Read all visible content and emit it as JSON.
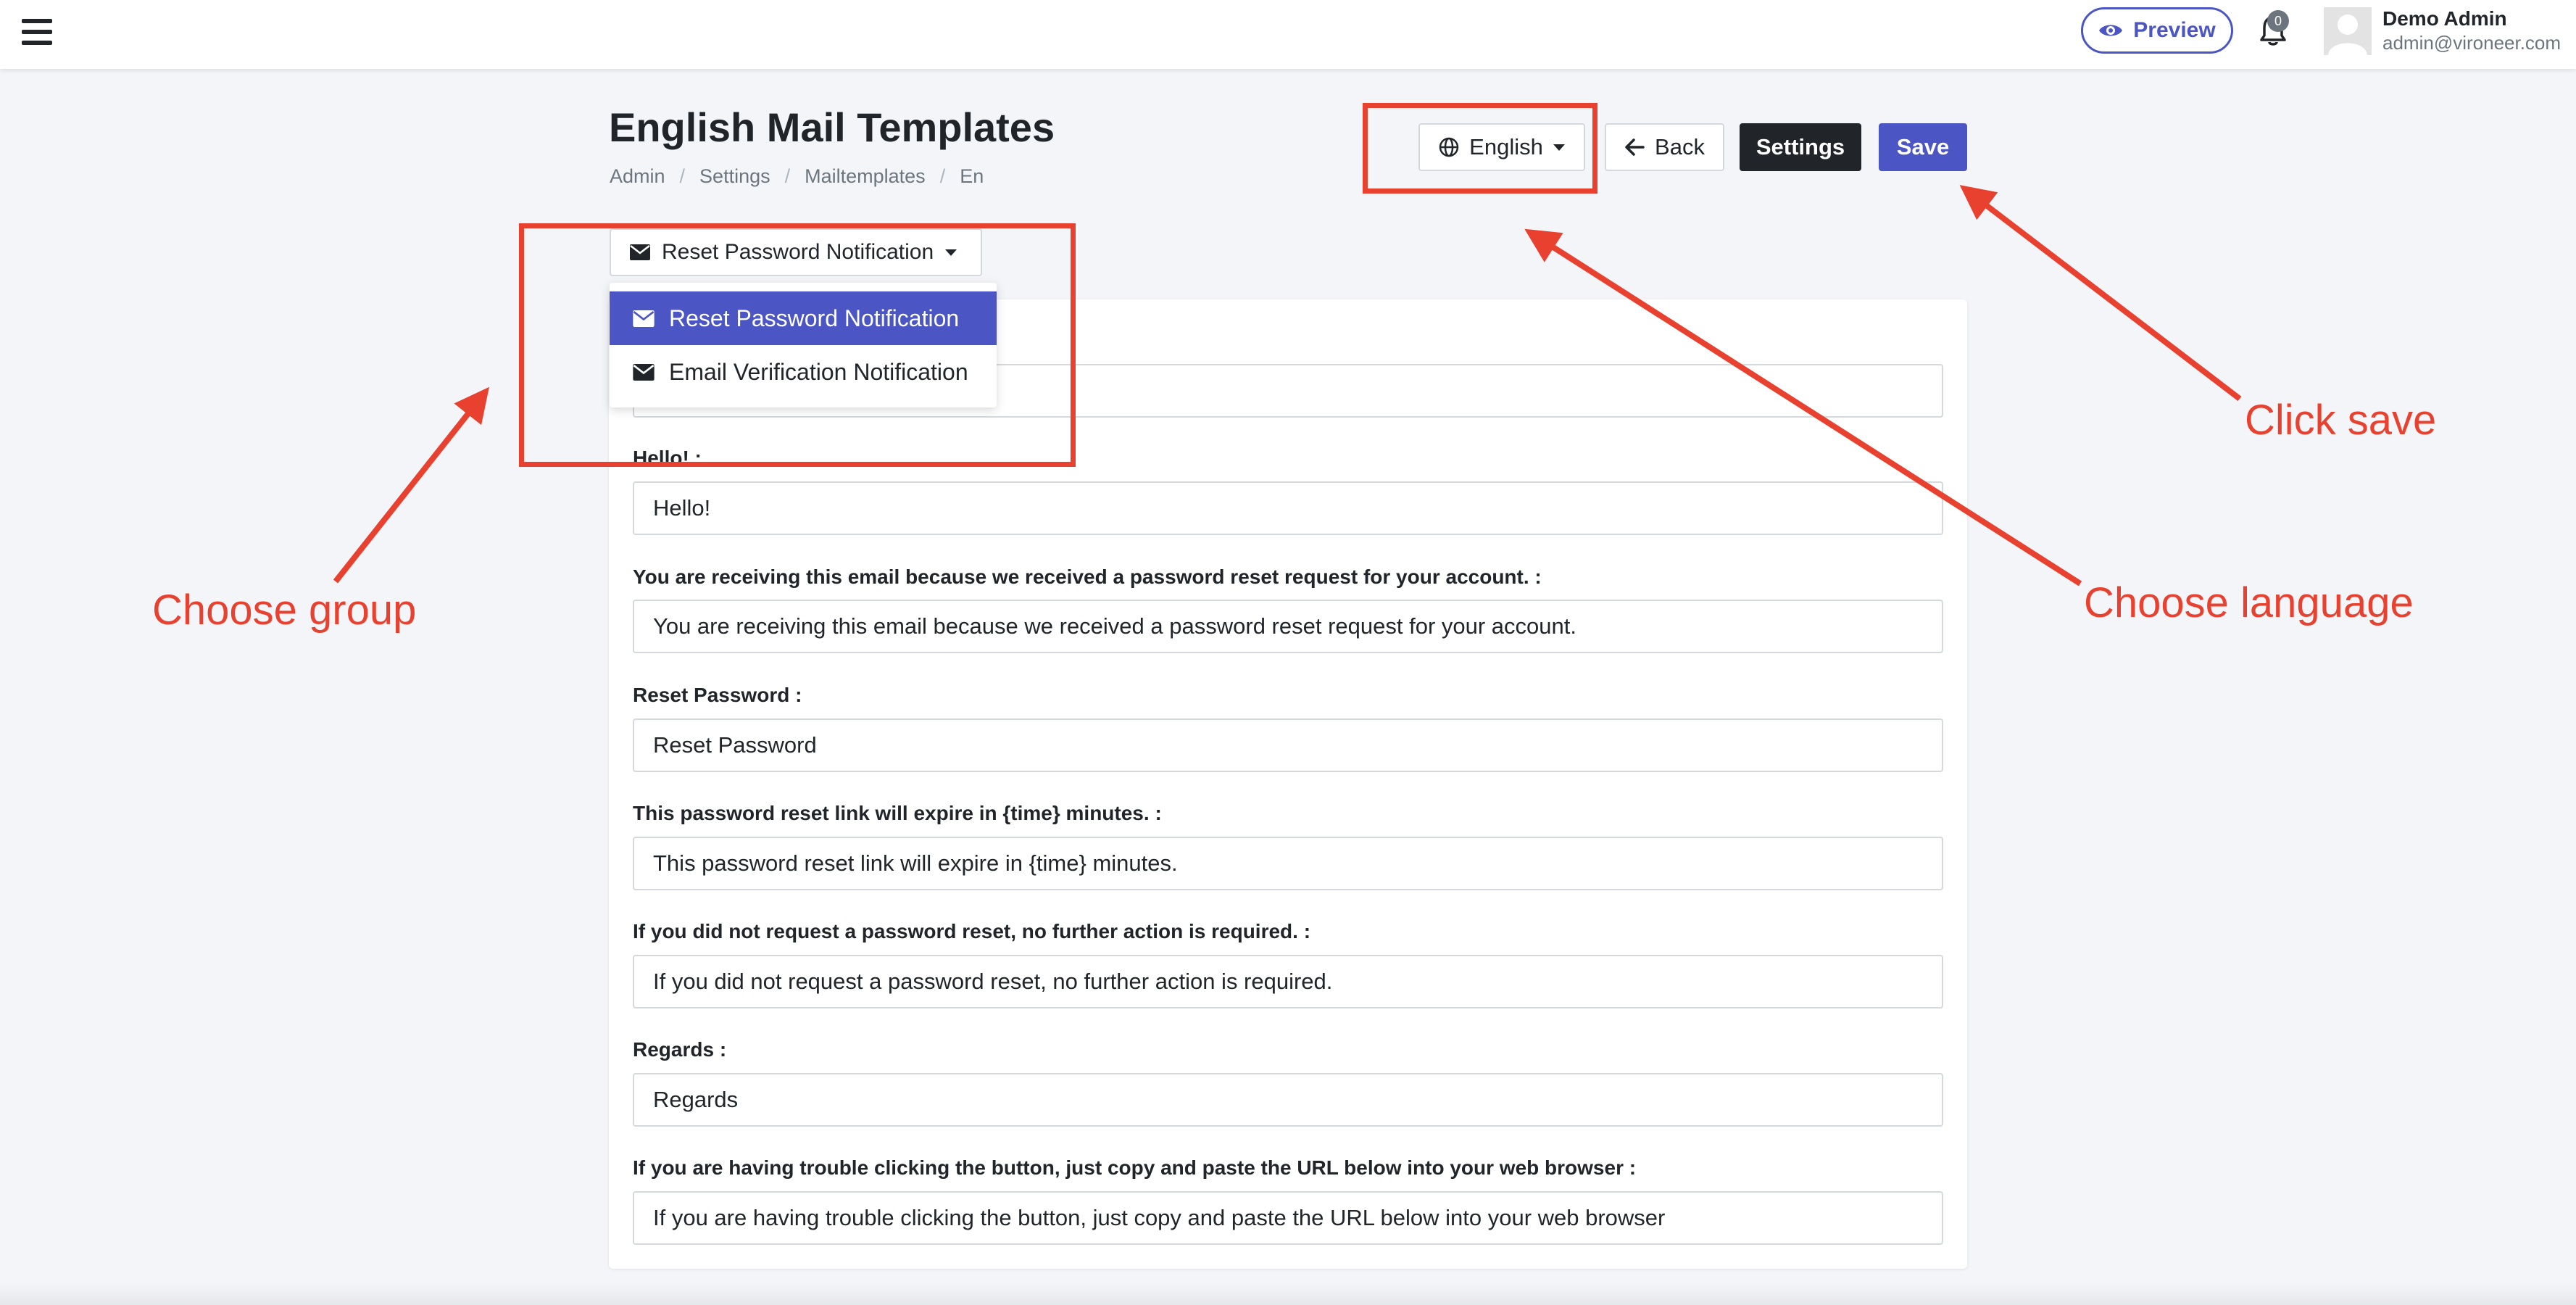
{
  "topbar": {
    "preview_label": "Preview",
    "notification_count": "0",
    "user_name": "Demo Admin",
    "user_email": "admin@vironeer.com"
  },
  "page": {
    "title": "English Mail Templates",
    "breadcrumb": [
      "Admin",
      "Settings",
      "Mailtemplates",
      "En"
    ]
  },
  "actions": {
    "language_label": "English",
    "back_label": "Back",
    "settings_label": "Settings",
    "save_label": "Save"
  },
  "group_dropdown": {
    "selected": "Reset Password Notification",
    "items": [
      {
        "label": "Reset Password Notification",
        "active": true
      },
      {
        "label": "Email Verification Notification",
        "active": false
      }
    ]
  },
  "form": {
    "fields": [
      {
        "label": "",
        "value": ""
      },
      {
        "label": "Hello! :",
        "value": "Hello!"
      },
      {
        "label": "You are receiving this email because we received a password reset request for your account. :",
        "value": "You are receiving this email because we received a password reset request for your account."
      },
      {
        "label": "Reset Password :",
        "value": "Reset Password"
      },
      {
        "label": "This password reset link will expire in {time} minutes. :",
        "value": "This password reset link will expire in {time} minutes."
      },
      {
        "label": "If you did not request a password reset, no further action is required. :",
        "value": "If you did not request a password reset, no further action is required."
      },
      {
        "label": "Regards :",
        "value": "Regards"
      },
      {
        "label": "If you are having trouble clicking the button, just copy and paste the URL below into your web browser :",
        "value": "If you are having trouble clicking the button, just copy and paste the URL below into your web browser"
      }
    ]
  },
  "annotations": {
    "choose_group": "Choose group",
    "choose_language": "Choose language",
    "click_save": "Click save",
    "color": "#e8412f"
  },
  "colors": {
    "accent": "#4b55c4",
    "dark_button": "#212529",
    "background": "#f4f5f9"
  },
  "icons": {
    "menu": "hamburger-icon",
    "preview": "eye-icon",
    "notifications": "bell-icon",
    "language": "globe-icon",
    "back": "arrow-left-icon",
    "group_items": "envelope-icon"
  }
}
